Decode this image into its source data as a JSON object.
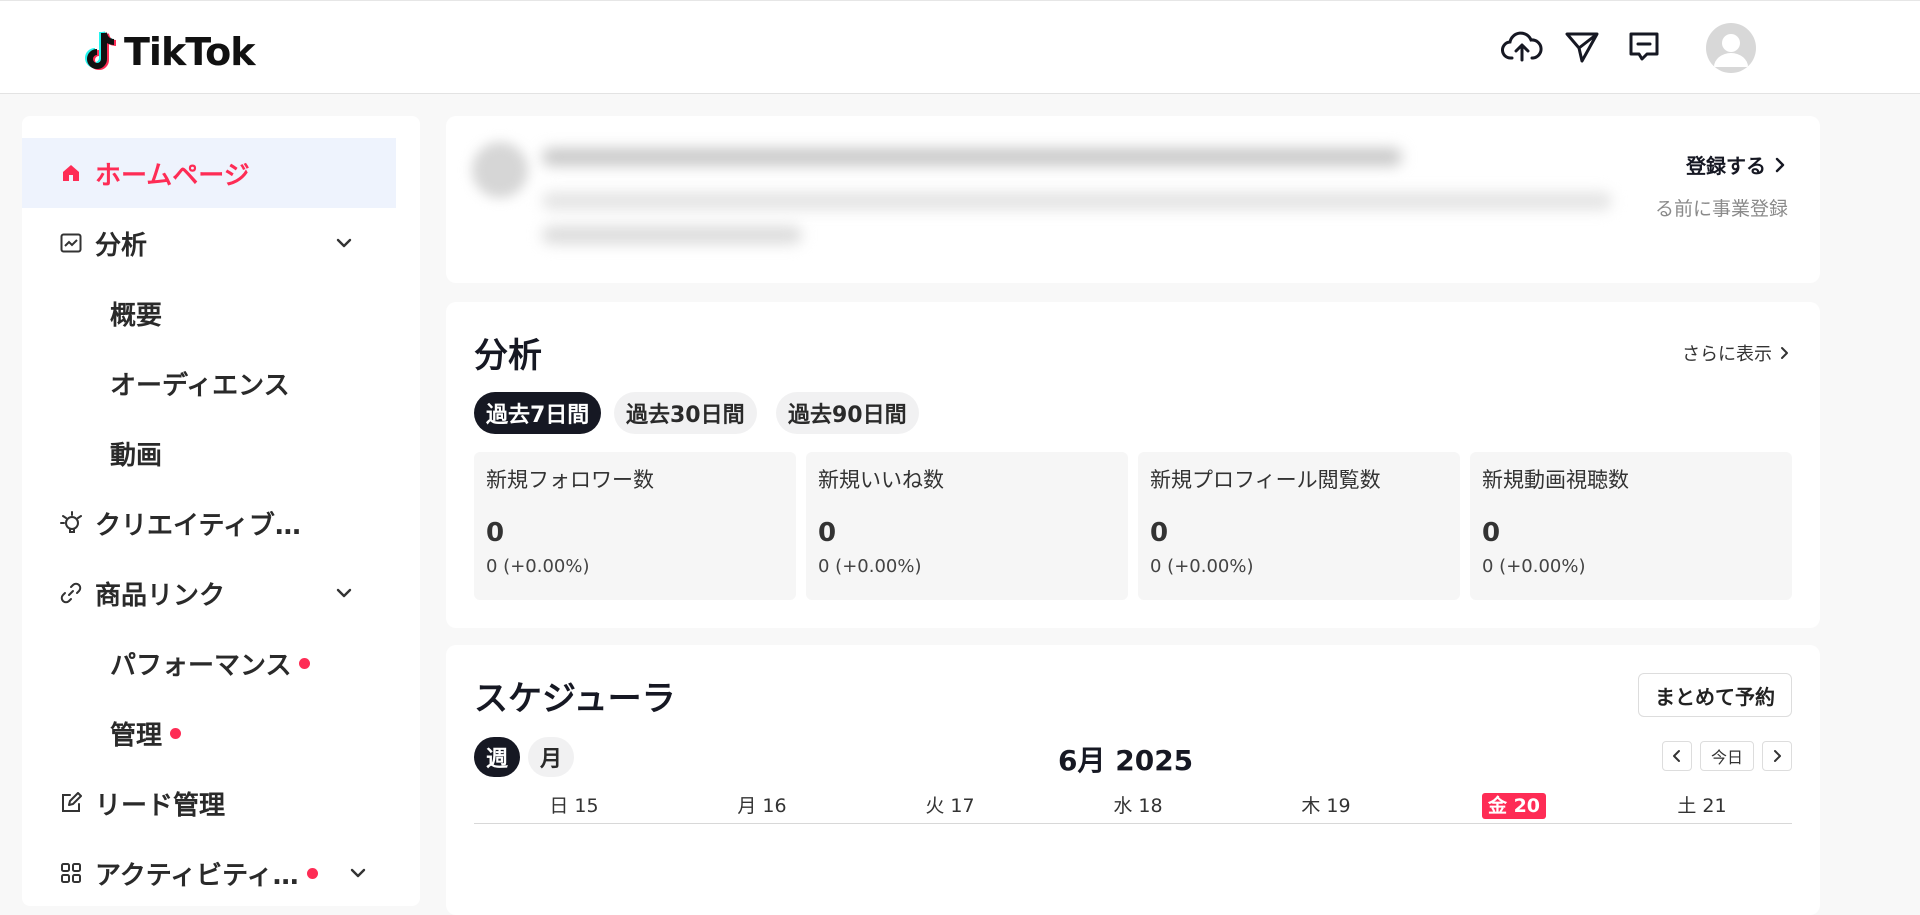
{
  "header": {
    "logo_text": "TikTok",
    "icons": [
      "upload-cloud-icon",
      "send-icon",
      "message-icon"
    ],
    "avatar": "avatar"
  },
  "sidebar": {
    "items": [
      {
        "label": "ホームページ",
        "icon": "home-icon",
        "active": true
      },
      {
        "label": "分析",
        "icon": "analytics-icon",
        "expandable": true
      },
      {
        "label": "概要"
      },
      {
        "label": "オーディエンス"
      },
      {
        "label": "動画"
      },
      {
        "label": "クリエイティブ…",
        "icon": "lightbulb-icon"
      },
      {
        "label": "商品リンク",
        "icon": "link-icon",
        "expandable": true
      },
      {
        "label": "パフォーマンス",
        "badge": true
      },
      {
        "label": "管理",
        "badge": true
      },
      {
        "label": "リード管理",
        "icon": "edit-icon"
      },
      {
        "label": "アクティビティ…",
        "icon": "apps-icon",
        "badge": true,
        "expandable": true
      }
    ]
  },
  "banner": {
    "register_label": "登録する",
    "register_note": "る前に事業登録"
  },
  "analytics": {
    "title": "分析",
    "more_label": "さらに表示",
    "periods": [
      "過去7日間",
      "過去30日間",
      "過去90日間"
    ],
    "selected_period": 0,
    "stats": [
      {
        "label": "新規フォロワー数",
        "value": "0",
        "change": "0 (+0.00%)"
      },
      {
        "label": "新規いいね数",
        "value": "0",
        "change": "0 (+0.00%)"
      },
      {
        "label": "新規プロフィール閲覧数",
        "value": "0",
        "change": "0 (+0.00%)"
      },
      {
        "label": "新規動画視聴数",
        "value": "0",
        "change": "0 (+0.00%)"
      }
    ]
  },
  "scheduler": {
    "title": "スケジューラ",
    "bulk_label": "まとめて予約",
    "views": [
      "週",
      "月"
    ],
    "selected_view": 0,
    "month_label": "6月 2025",
    "today_label": "今日",
    "days": [
      "日 15",
      "月 16",
      "火 17",
      "水 18",
      "木 19",
      "金 20",
      "土 21"
    ],
    "today_index": 5
  },
  "colors": {
    "accent": "#fe2c55",
    "active_bg": "#eef3fd",
    "dark": "#161823"
  }
}
